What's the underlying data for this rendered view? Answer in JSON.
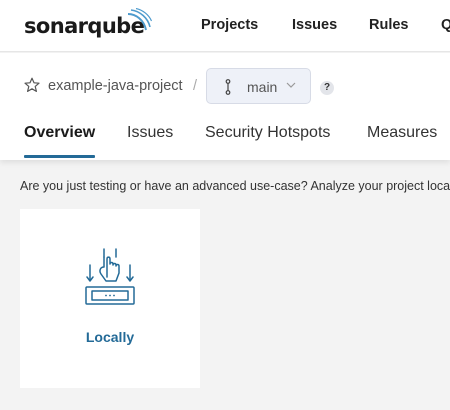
{
  "app": {
    "logo_text": "sonarqube",
    "nav": [
      "Projects",
      "Issues",
      "Rules",
      "Q"
    ]
  },
  "project": {
    "name": "example-java-project",
    "separator": "/",
    "branch": "main",
    "help": "?"
  },
  "tabs": [
    "Overview",
    "Issues",
    "Security Hotspots",
    "Measures"
  ],
  "active_tab": "Overview",
  "content": {
    "intro": "Are you just testing or have an advanced use-case? Analyze your project locally.",
    "card_label": "Locally"
  },
  "colors": {
    "brand": "#236a97",
    "logo_waves": "#4e9bcd"
  }
}
